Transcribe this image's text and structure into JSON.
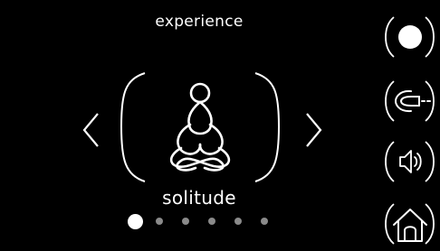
{
  "screen": {
    "title": "experience",
    "caption": "solitude"
  },
  "carousel": {
    "page_count": 6,
    "active_index": 0
  },
  "icons": {
    "prev": "chevron-left-icon",
    "next": "chevron-right-icon",
    "center": "meditation-figure-icon",
    "record": "record-icon",
    "connector": "audio-jack-icon",
    "volume": "speaker-icon",
    "home": "home-icon"
  },
  "colors": {
    "background": "#000000",
    "foreground": "#ffffff",
    "inactive_dot": "#8a8a8a"
  }
}
